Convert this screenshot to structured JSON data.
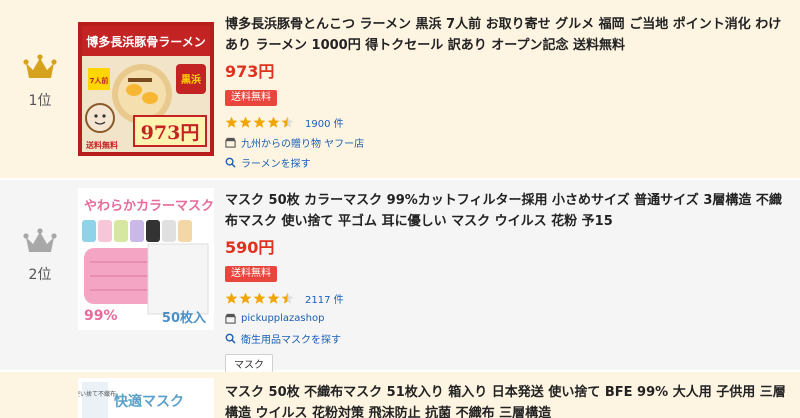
{
  "colors": {
    "gold": "#d6a21e",
    "silver": "#a8a8a8",
    "price": "#e0301e",
    "badge": "#e8453c",
    "star": "#f0a500",
    "link": "#1a5fb4"
  },
  "items": [
    {
      "rank_label": "1位",
      "crown_icon": "gold-crown-icon",
      "title": "博多長浜豚骨とんこつ ラーメン 黒浜 7人前 お取り寄せ グルメ 福岡 ご当地 ポイント消化 わけあり ラーメン 1000円 得トクセール 訳あり オープン記念 送料無料",
      "price": "973円",
      "badge": "送料無料",
      "rating": 4.5,
      "review_count": "1900 件",
      "shop": "九州からの贈り物 ヤフー店",
      "search_link": "ラーメンを探す",
      "thumb": {
        "banner": "博多長浜豚骨ラーメン",
        "servings": "7人前",
        "label": "黒浜",
        "price": "973円",
        "shipping": "送料無料"
      }
    },
    {
      "rank_label": "2位",
      "crown_icon": "silver-crown-icon",
      "title": "マスク 50枚 カラーマスク 99%カットフィルター採用 小さめサイズ 普通サイズ 3層構造 不織布マスク 使い捨て 平ゴム 耳に優しい マスク ウイルス 花粉 予15",
      "price": "590円",
      "badge": "送料無料",
      "rating": 4.5,
      "review_count": "2117 件",
      "shop": "pickupplazashop",
      "search_link": "衛生用品マスクを探す",
      "tag": "マスク",
      "thumb": {
        "heading": "やわらかカラーマスク",
        "percent": "99%",
        "count": "50枚入"
      }
    },
    {
      "title": "マスク 50枚 不織布マスク 51枚入り 箱入り 日本発送 使い捨て BFE 99% 大人用 子供用 三層構造 ウイルス 花粉対策 飛沫防止 抗菌 不織布 三層構造",
      "thumb": {
        "side_text": "使い捨て不織布",
        "heading": "快適マスク"
      }
    }
  ]
}
